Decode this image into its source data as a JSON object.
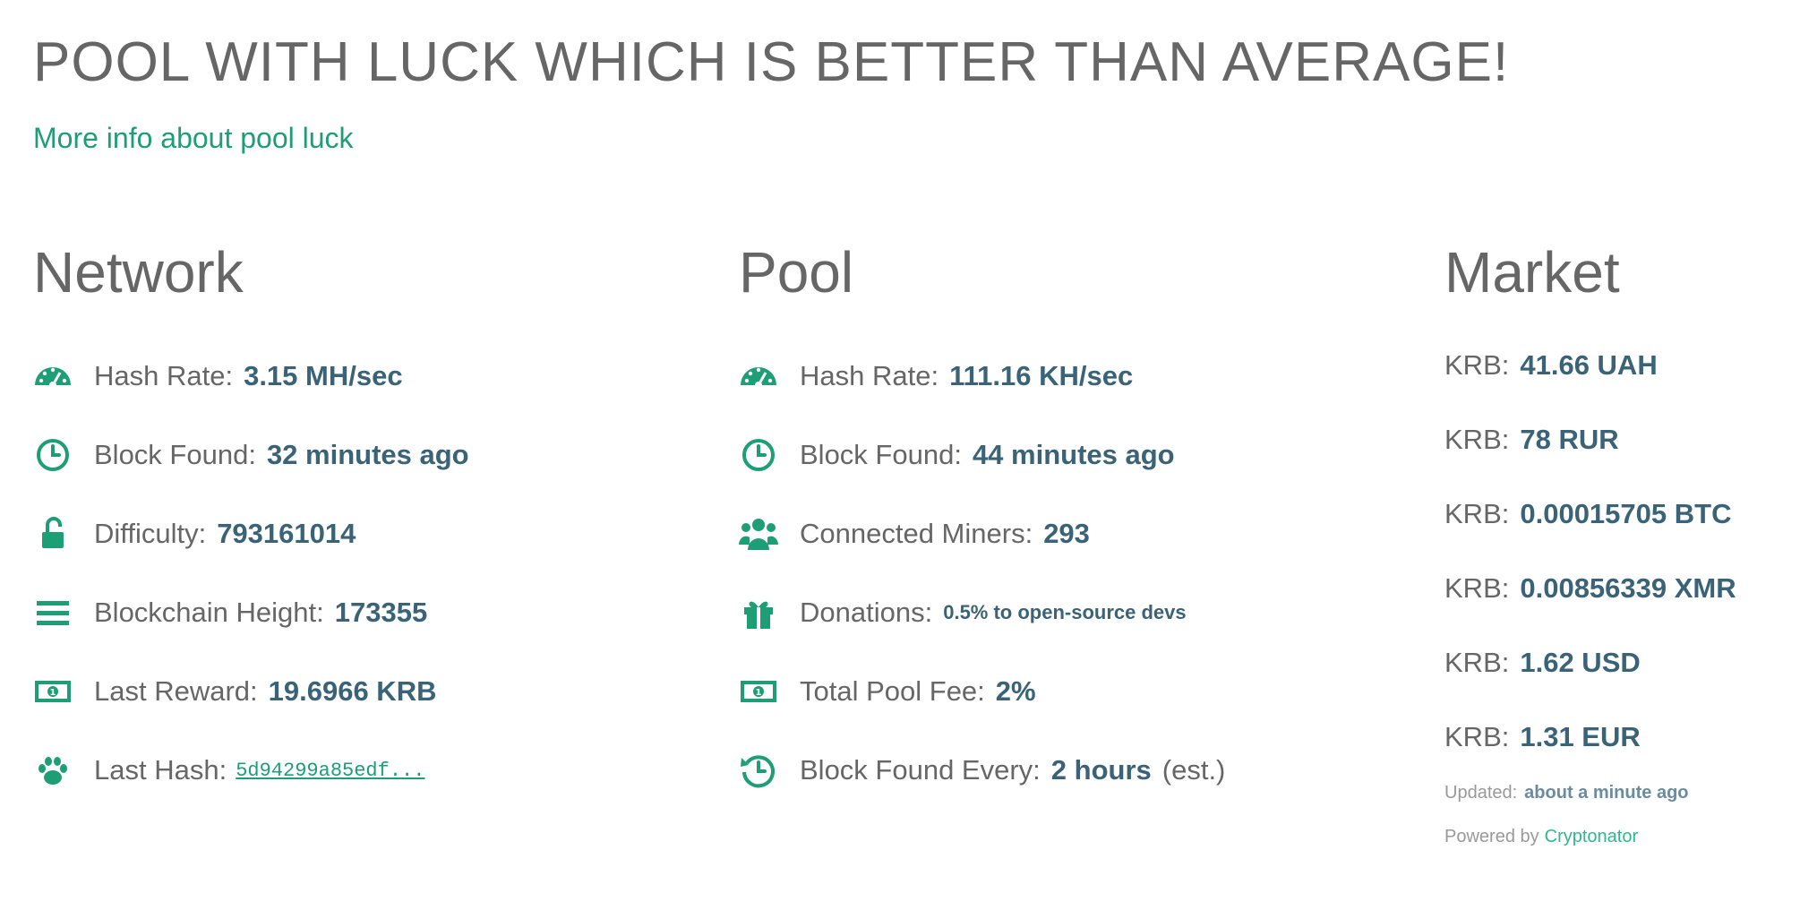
{
  "header": {
    "title": "POOL WITH LUCK WHICH IS BETTER THAN AVERAGE!",
    "luck_link": "More info about pool luck"
  },
  "colors": {
    "accent": "#1e9e75",
    "value": "#3b6378",
    "text": "#666666"
  },
  "network": {
    "heading": "Network",
    "hash_rate": {
      "icon": "dashboard-icon",
      "label": "Hash Rate:",
      "value": "3.15 MH/sec"
    },
    "block_found": {
      "icon": "clock-icon",
      "label": "Block Found:",
      "value": "32 minutes ago"
    },
    "difficulty": {
      "icon": "unlock-icon",
      "label": "Difficulty:",
      "value": "793161014"
    },
    "height": {
      "icon": "bars-icon",
      "label": "Blockchain Height:",
      "value": "173355"
    },
    "reward": {
      "icon": "money-icon",
      "label": "Last Reward:",
      "value": "19.6966 KRB"
    },
    "last_hash": {
      "icon": "paw-icon",
      "label": "Last Hash:",
      "value": "5d94299a85edf..."
    }
  },
  "pool": {
    "heading": "Pool",
    "hash_rate": {
      "icon": "dashboard-icon",
      "label": "Hash Rate:",
      "value": "111.16 KH/sec"
    },
    "block_found": {
      "icon": "clock-icon",
      "label": "Block Found:",
      "value": "44 minutes ago"
    },
    "miners": {
      "icon": "users-icon",
      "label": "Connected Miners:",
      "value": "293"
    },
    "donations": {
      "icon": "gift-icon",
      "label": "Donations:",
      "value": "0.5% to open-source devs"
    },
    "fee": {
      "icon": "money-icon",
      "label": "Total Pool Fee:",
      "value": "2%"
    },
    "every": {
      "icon": "history-icon",
      "label": "Block Found Every:",
      "value": "2 hours",
      "suffix": "(est.)"
    }
  },
  "market": {
    "heading": "Market",
    "rates": [
      {
        "label": "KRB:",
        "value": "41.66 UAH"
      },
      {
        "label": "KRB:",
        "value": "78 RUR"
      },
      {
        "label": "KRB:",
        "value": "0.00015705 BTC"
      },
      {
        "label": "KRB:",
        "value": "0.00856339 XMR"
      },
      {
        "label": "KRB:",
        "value": "1.62 USD"
      },
      {
        "label": "KRB:",
        "value": "1.31 EUR"
      }
    ],
    "updated_label": "Updated:",
    "updated_value": "about a minute ago",
    "powered_label": "Powered by",
    "powered_link": "Cryptonator"
  }
}
